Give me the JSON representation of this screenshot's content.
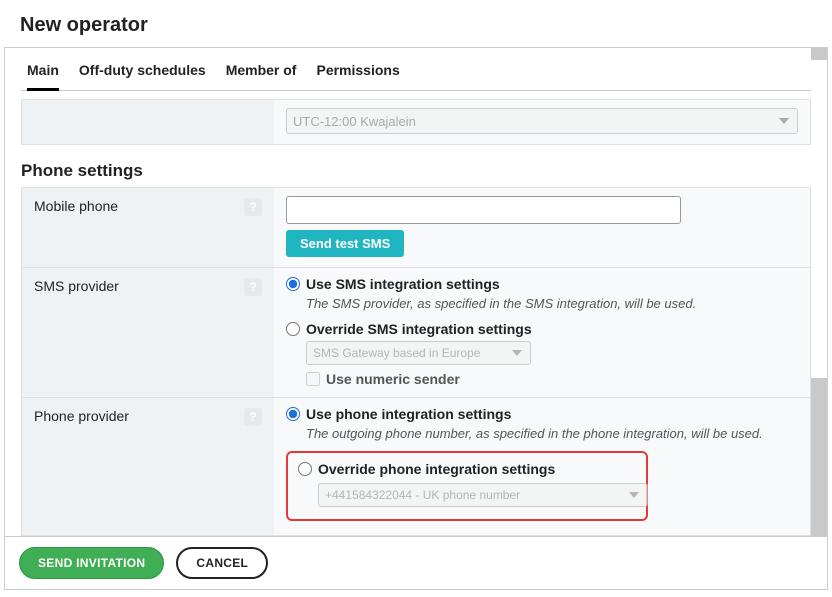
{
  "page_title": "New operator",
  "tabs": [
    {
      "label": "Main",
      "active": true
    },
    {
      "label": "Off-duty schedules",
      "active": false
    },
    {
      "label": "Member of",
      "active": false
    },
    {
      "label": "Permissions",
      "active": false
    }
  ],
  "timezone": {
    "value": "UTC-12:00 Kwajalein"
  },
  "section_heading": "Phone settings",
  "mobile_phone": {
    "label": "Mobile phone",
    "value": "",
    "test_button": "Send test SMS"
  },
  "sms_provider": {
    "label": "SMS provider",
    "use_integration": {
      "label": "Use SMS integration settings",
      "description": "The SMS provider, as specified in the SMS integration, will be used."
    },
    "override": {
      "label": "Override SMS integration settings",
      "gateway": "SMS Gateway based in Europe",
      "numeric_sender_label": "Use numeric sender"
    }
  },
  "phone_provider": {
    "label": "Phone provider",
    "use_integration": {
      "label": "Use phone integration settings",
      "description": "The outgoing phone number, as specified in the phone integration, will be used."
    },
    "override": {
      "label": "Override phone integration settings",
      "number": "+441584322044 - UK phone number"
    }
  },
  "footer": {
    "send_invitation": "SEND INVITATION",
    "cancel": "CANCEL"
  }
}
